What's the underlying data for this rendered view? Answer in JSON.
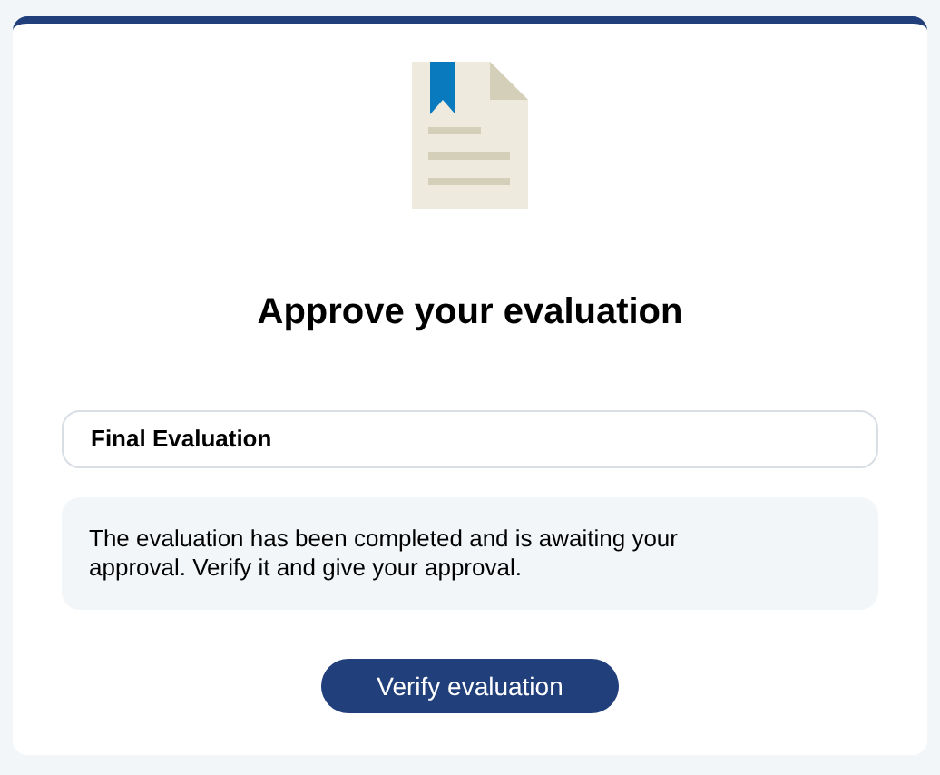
{
  "title": "Approve your evaluation",
  "evaluation_name": "Final Evaluation",
  "message": "The evaluation has been completed and is awaiting your approval. Verify it and give your approval.",
  "button": "Verify evaluation"
}
